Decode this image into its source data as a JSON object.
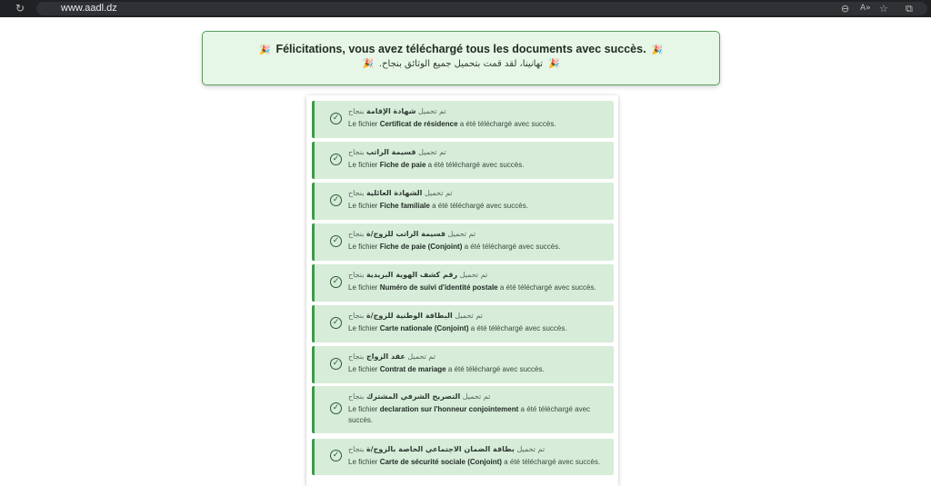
{
  "browser": {
    "url": "www.aadl.dz",
    "reload_icon": "↻",
    "zoom_icon": "⊖",
    "read_icon": "A»",
    "star_icon": "☆",
    "ext_icon": "⧉"
  },
  "banner": {
    "emoji": "🎉",
    "message_fr": "Félicitations, vous avez téléchargé tous les documents avec succès.",
    "message_ar": "تهانينا، لقد قمت بتحميل جميع الوثائق بنجاح."
  },
  "labels": {
    "ar_prefix": "تم تحميل",
    "ar_suffix": "بنجاح",
    "fr_prefix": "Le fichier",
    "fr_suffix": "a été téléchargé avec succès."
  },
  "check_icon": "✓",
  "documents": [
    {
      "ar": "شهادة الإقامة",
      "fr": "Certificat de résidence"
    },
    {
      "ar": "قسيمة الراتب",
      "fr": "Fiche de paie"
    },
    {
      "ar": "الشهادة العائلية",
      "fr": "Fiche familiale"
    },
    {
      "ar": "قسيمة الراتب للزوج/ة",
      "fr": "Fiche de paie (Conjoint)"
    },
    {
      "ar": "رقم كشف الهوية البريدية",
      "fr": "Numéro de suivi d'identité postale"
    },
    {
      "ar": "البطاقة الوطنية للزوج/ة",
      "fr": "Carte nationale (Conjoint)"
    },
    {
      "ar": "عقد الزواج",
      "fr": "Contrat de mariage"
    },
    {
      "ar": "التصريح الشرفي المشترك",
      "fr": "declaration sur l'honneur conjointement"
    },
    {
      "ar": "بطاقة الضمان الاجتماعي الخاصة بالزوج/ة",
      "fr": "Carte de sécurité sociale (Conjoint)"
    }
  ]
}
